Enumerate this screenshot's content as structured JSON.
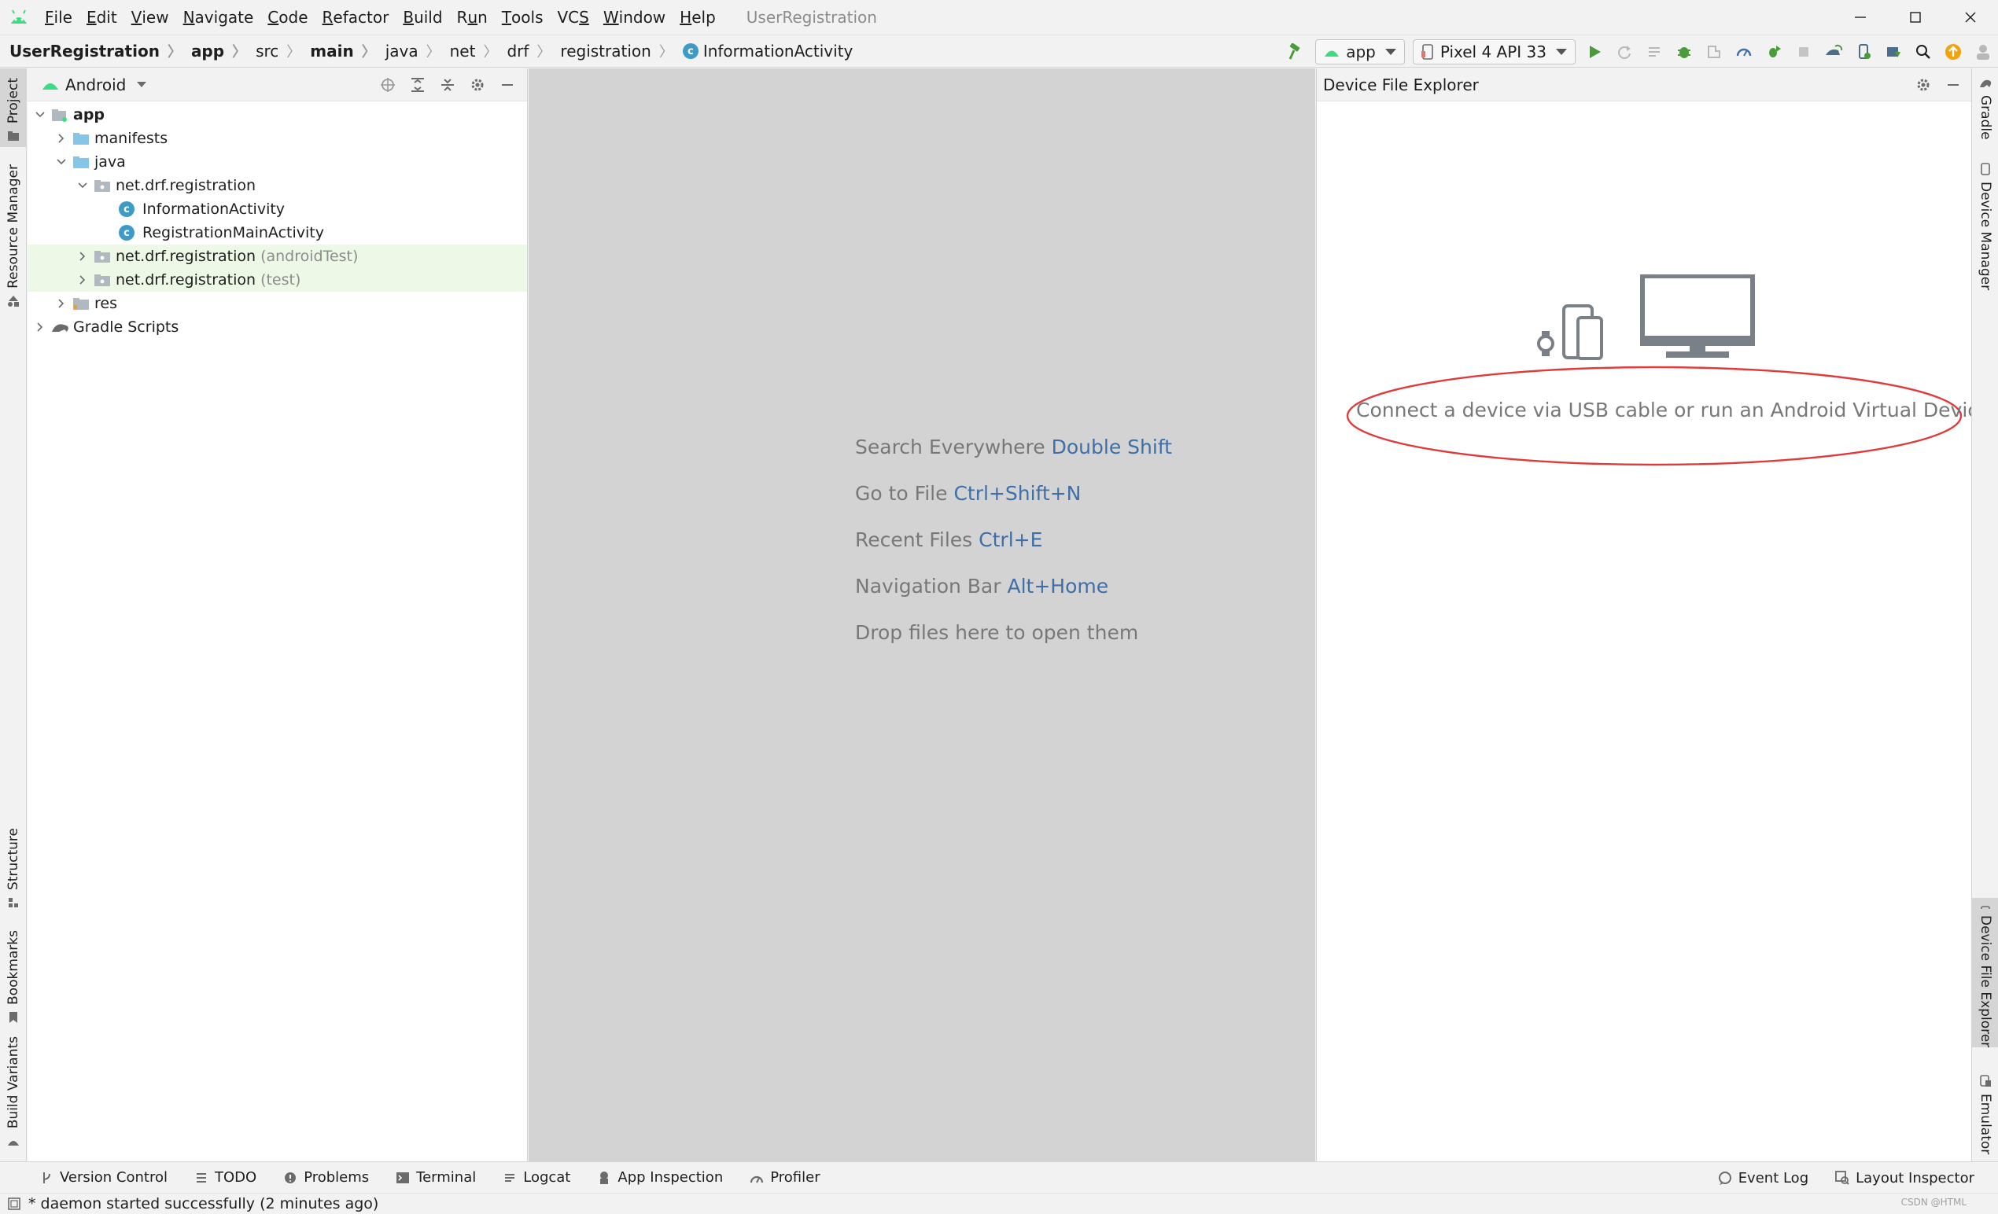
{
  "window": {
    "title": "UserRegistration"
  },
  "menu": [
    {
      "label_pre": "",
      "mnemonic": "F",
      "label_post": "ile"
    },
    {
      "label_pre": "",
      "mnemonic": "E",
      "label_post": "dit"
    },
    {
      "label_pre": "",
      "mnemonic": "V",
      "label_post": "iew"
    },
    {
      "label_pre": "",
      "mnemonic": "N",
      "label_post": "avigate"
    },
    {
      "label_pre": "",
      "mnemonic": "C",
      "label_post": "ode"
    },
    {
      "label_pre": "",
      "mnemonic": "R",
      "label_post": "efactor"
    },
    {
      "label_pre": "",
      "mnemonic": "B",
      "label_post": "uild"
    },
    {
      "label_pre": "R",
      "mnemonic": "u",
      "label_post": "n"
    },
    {
      "label_pre": "",
      "mnemonic": "T",
      "label_post": "ools"
    },
    {
      "label_pre": "VC",
      "mnemonic": "S",
      "label_post": ""
    },
    {
      "label_pre": "",
      "mnemonic": "W",
      "label_post": "indow"
    },
    {
      "label_pre": "",
      "mnemonic": "H",
      "label_post": "elp"
    }
  ],
  "breadcrumb": [
    "UserRegistration",
    "app",
    "src",
    "main",
    "java",
    "net",
    "drf",
    "registration",
    "InformationActivity"
  ],
  "toolbar": {
    "run_config": "app",
    "device": "Pixel 4 API 33",
    "colors": {
      "run": "#4a9c3a",
      "accent": "#f0a30a"
    }
  },
  "left_stripe": {
    "tabs": [
      "Project",
      "Resource Manager",
      "Structure",
      "Bookmarks",
      "Build Variants"
    ]
  },
  "right_stripe": {
    "tabs": [
      "Gradle",
      "Device Manager",
      "Device File Explorer",
      "Emulator"
    ]
  },
  "project": {
    "view": "Android",
    "tree": [
      {
        "label": "app",
        "suffix": ""
      },
      {
        "label": "manifests",
        "suffix": ""
      },
      {
        "label": "java",
        "suffix": ""
      },
      {
        "label": "net.drf.registration",
        "suffix": ""
      },
      {
        "label": "InformationActivity",
        "suffix": ""
      },
      {
        "label": "RegistrationMainActivity",
        "suffix": ""
      },
      {
        "label": "net.drf.registration",
        "suffix": "(androidTest)"
      },
      {
        "label": "net.drf.registration",
        "suffix": "(test)"
      },
      {
        "label": "res",
        "suffix": ""
      },
      {
        "label": "Gradle Scripts",
        "suffix": ""
      }
    ]
  },
  "editor": {
    "hints": [
      {
        "text": "Search Everywhere",
        "key": "Double Shift"
      },
      {
        "text": "Go to File",
        "key": "Ctrl+Shift+N"
      },
      {
        "text": "Recent Files",
        "key": "Ctrl+E"
      },
      {
        "text": "Navigation Bar",
        "key": "Alt+Home"
      },
      {
        "text": "Drop files here to open them",
        "key": ""
      }
    ]
  },
  "device_file_explorer": {
    "title": "Device File Explorer",
    "message": "Connect a device via USB cable or run an Android Virtual Device"
  },
  "bottom_tabs": [
    "Version Control",
    "TODO",
    "Problems",
    "Terminal",
    "Logcat",
    "App Inspection",
    "Profiler"
  ],
  "bottom_right_tabs": [
    "Event Log",
    "Layout Inspector"
  ],
  "status": {
    "text": "* daemon started successfully (2 minutes ago)",
    "watermark": "CSDN @HTML"
  }
}
